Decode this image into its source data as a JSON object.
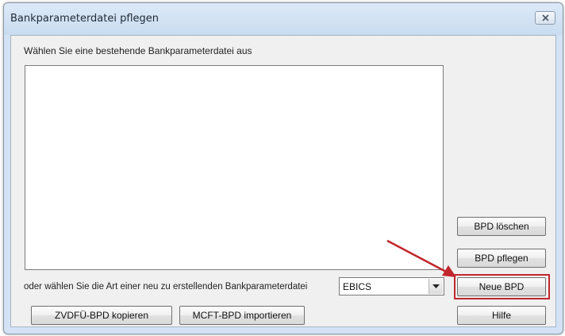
{
  "window": {
    "title": "Bankparameterdatei pflegen",
    "close_icon": "close-icon"
  },
  "main": {
    "instruction": "Wählen Sie eine bestehende Bankparameterdatei aus",
    "files_list": []
  },
  "buttons": {
    "delete": "BPD löschen",
    "edit": "BPD pflegen",
    "new": "Neue BPD",
    "help": "Hilfe",
    "copy_zvdfu": "ZVDFÜ-BPD kopieren",
    "import_mcft": "MCFT-BPD importieren"
  },
  "new_type": {
    "label": "oder wählen Sie die Art einer neu zu erstellenden Bankparameterdatei",
    "selected": "EBICS"
  },
  "annotation": {
    "color": "#c0272d",
    "arrow_icon": "red-arrow-annotation",
    "highlight_target": "Neue BPD"
  },
  "colors": {
    "titlebar": "#d3e3f5",
    "client": "#f0f0f0",
    "highlight": "#c0272d"
  }
}
